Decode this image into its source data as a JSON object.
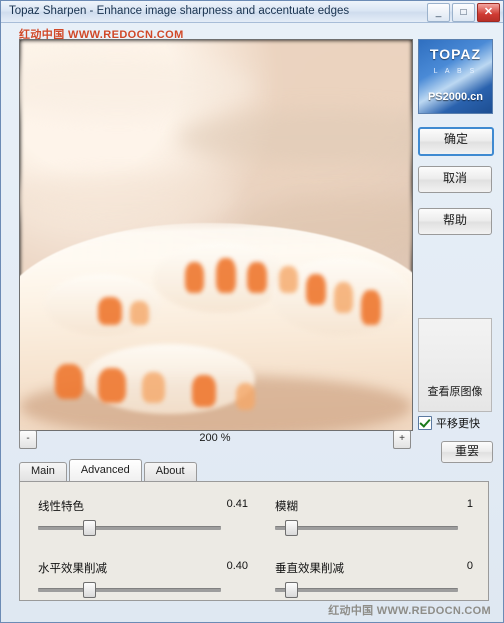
{
  "window": {
    "title": "Topaz Sharpen - Enhance image sharpness and accentuate edges",
    "buttons": {
      "minimize": "_",
      "maximize": "□",
      "close": "✕"
    }
  },
  "watermarks": {
    "top": "红动中国 WWW.REDOCN.COM",
    "bottom": "红动中国 WWW.REDOCN.COM"
  },
  "preview": {
    "zoom_out": "-",
    "zoom_in": "+",
    "zoom_level": "200 %"
  },
  "logo": {
    "brand": "TOPAZ",
    "sub": "L A B S",
    "overlay": "PS2000.cn"
  },
  "right_buttons": {
    "ok": "确定",
    "cancel": "取消",
    "help": "帮助",
    "view_original": "查看原图像",
    "fast_pan_label": "平移更快",
    "reset": "重罢"
  },
  "tabs": [
    {
      "label": "Main",
      "active": false
    },
    {
      "label": "Advanced",
      "active": true
    },
    {
      "label": "About",
      "active": false
    }
  ],
  "controls": [
    {
      "name": "线性特色",
      "value": "0.41",
      "pct": 26
    },
    {
      "name": "模糊",
      "value": "1",
      "pct": 6
    },
    {
      "name": "水平效果削减",
      "value": "0.40",
      "pct": 26
    },
    {
      "name": "垂直效果削减",
      "value": "0",
      "pct": 6
    }
  ]
}
